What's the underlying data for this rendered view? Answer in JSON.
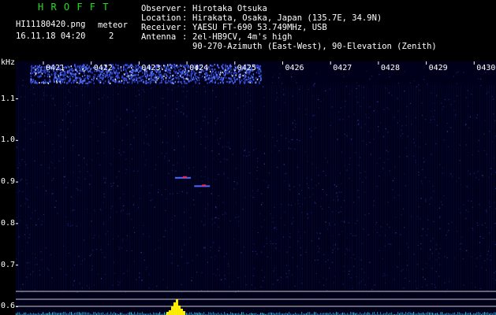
{
  "header": {
    "app_title": "H R O F F T",
    "filename": "HI11180420.png",
    "datetime": "16.11.18 04:20",
    "meteor_label": "meteor",
    "meteor_count": "2",
    "info_keys": [
      "Observer",
      "Location",
      "Receiver",
      "Antenna"
    ],
    "info_values": [
      "Hirotaka Otsuka",
      "Hirakata, Osaka, Japan (135.7E, 34.9N)",
      "YAESU FT-690 53.749MHz, USB",
      "2el-HB9CV, 4m's high"
    ],
    "info_extra": "90-270-Azimuth (East-West), 90-Elevation (Zenith)",
    "title_color": "#22dd22",
    "text_color": "#ffffff"
  },
  "chart_data": {
    "type": "heatmap",
    "ylabel": "kHz",
    "x_ticks": [
      "0421",
      "0422",
      "0423",
      "0424",
      "0425",
      "0426",
      "0427",
      "0428",
      "0429",
      "0430"
    ],
    "y_ticks": [
      "1.1",
      "1.0",
      "0.9",
      "0.8",
      "0.7",
      "0.6"
    ],
    "y_values": [
      1.1,
      1.0,
      0.9,
      0.8,
      0.7,
      0.6
    ],
    "ylim": [
      0.58,
      1.19
    ],
    "x_minutes": [
      421,
      430
    ],
    "meteor_echoes": [
      {
        "time": "0423.8",
        "freq_khz": 0.91
      },
      {
        "time": "0424.2",
        "freq_khz": 0.89
      }
    ],
    "background_color": "#00001a",
    "noise_color": "#1a2a8a",
    "signal_color": "#ff2244",
    "spectrum_color": "#ffee00",
    "ref_line_color": "#dddddd"
  }
}
